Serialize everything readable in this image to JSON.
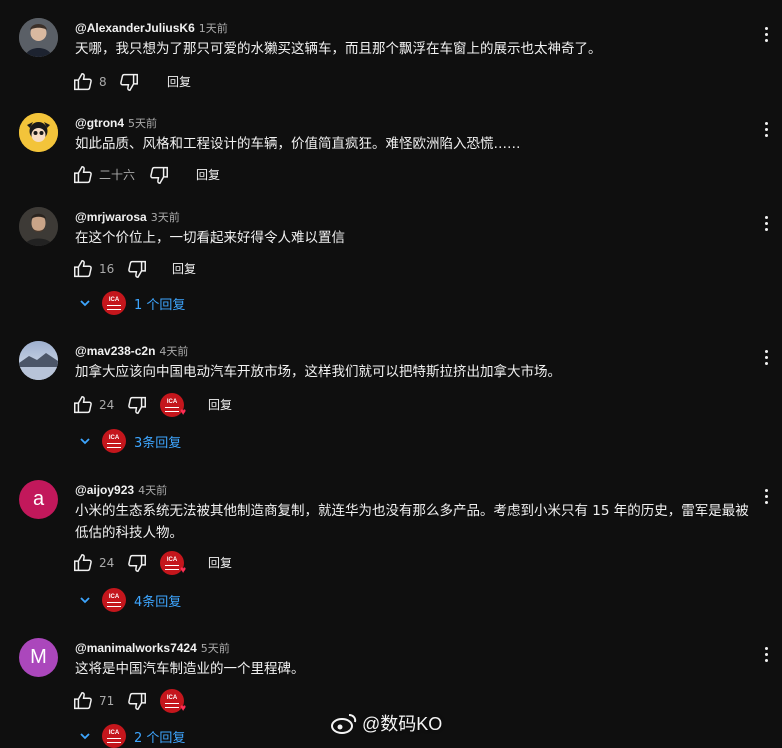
{
  "comments": [
    {
      "author": "@AlexanderJuliusK6",
      "time": "1天前",
      "text": "天哪，我只想为了那只可爱的水獭买这辆车，而且那个飘浮在车窗上的展示也太神奇了。",
      "likes": "8",
      "reply_label": "回复"
    },
    {
      "author": "@gtron4",
      "time": "5天前",
      "text": "如此品质、风格和工程设计的车辆，价值简直疯狂。难怪欧洲陷入恐慌……",
      "likes": "二十六",
      "reply_label": "回复"
    },
    {
      "author": "@mrjwarosa",
      "time": "3天前",
      "text": "在这个价位上，一切看起来好得令人难以置信",
      "likes": "16",
      "reply_label": "回复",
      "replies": "1 个回复"
    },
    {
      "author": "@mav238-c2n",
      "time": "4天前",
      "text": "加拿大应该向中国电动汽车开放市场，这样我们就可以把特斯拉挤出加拿大市场。",
      "likes": "24",
      "reply_label": "回复",
      "replies": "3条回复"
    },
    {
      "author": "@aijoy923",
      "time": "4天前",
      "text": "小米的生态系统无法被其他制造商复制，就连华为也没有那么多产品。考虑到小米只有 15 年的历史，雷军是最被低估的科技人物。",
      "likes": "24",
      "reply_label": "回复",
      "replies": "4条回复",
      "avatar_letter": "a",
      "avatar_color": "#c2185b"
    },
    {
      "author": "@manimalworks7424",
      "time": "5天前",
      "text": "这将是中国汽车制造业的一个里程碑。",
      "likes": "71",
      "reply_label": "回复",
      "replies": "2 个回复",
      "avatar_letter": "M",
      "avatar_color": "#ab47bc"
    }
  ],
  "creator_badge_text": "ICA",
  "watermark": "@数码KO",
  "colors": {
    "background": "#0f0f0f",
    "link": "#3ea6ff",
    "badge": "#c4161c"
  }
}
